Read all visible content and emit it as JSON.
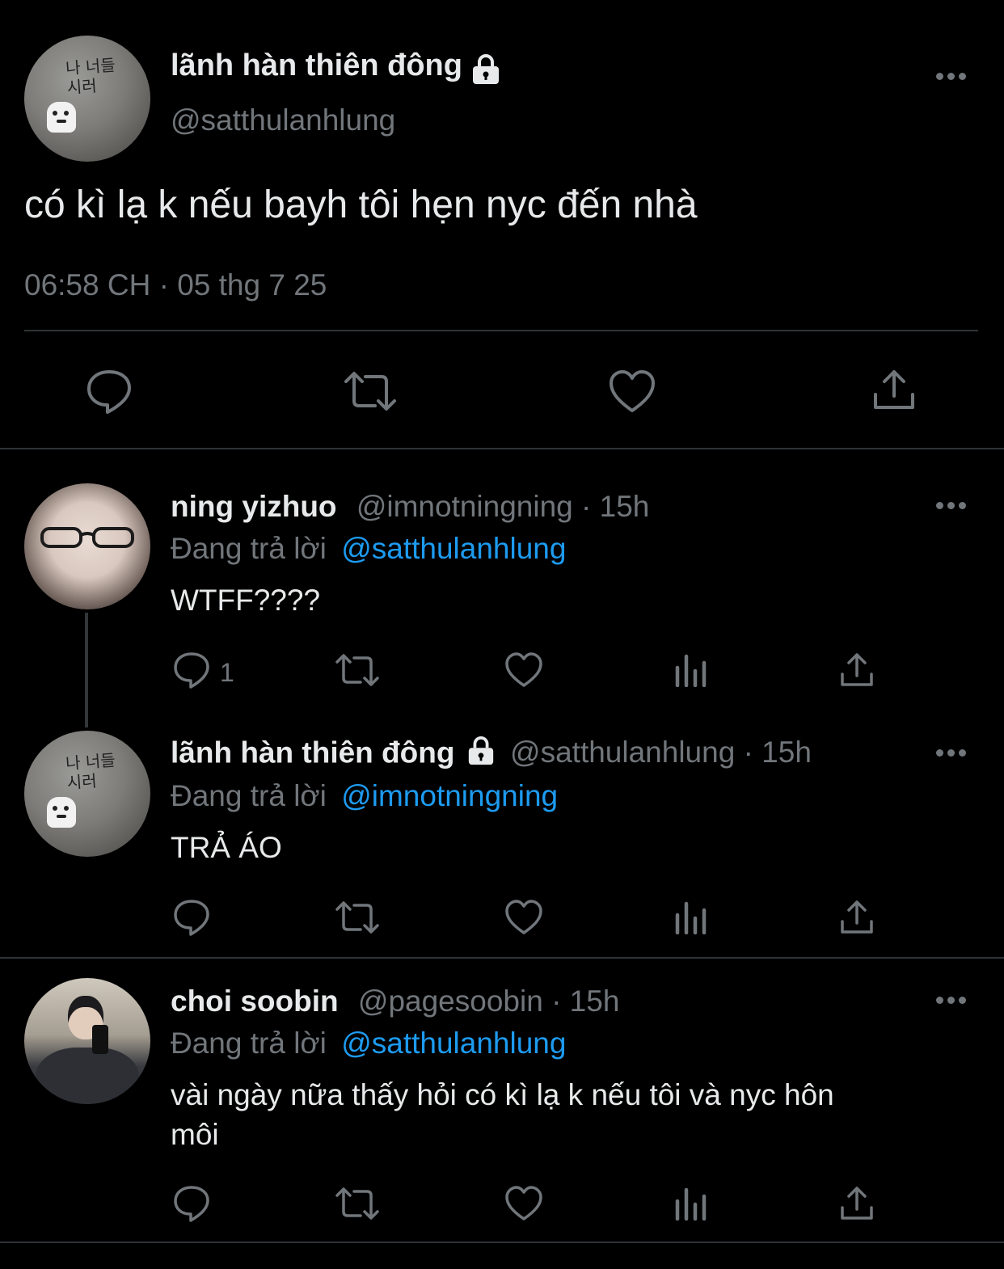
{
  "main_tweet": {
    "display_name": "lãnh hàn thiên đông",
    "handle": "@satthulanhlung",
    "text": "có kì lạ k nếu bayh tôi hẹn nyc đến nhà",
    "time": "06:58 CH · 05 thg 7 25",
    "avatar_graffiti": "나 너들 시러",
    "icons": [
      "reply-icon",
      "retweet-icon",
      "like-icon",
      "share-icon"
    ]
  },
  "replies": [
    {
      "display_name": "ning yizhuo",
      "meta": "@imnotningning · 15h",
      "replying_prefix": "Đang trả lời",
      "replying_to": "@satthulanhlung",
      "text": "WTFF????",
      "reply_count": "1"
    },
    {
      "display_name": "lãnh hàn thiên đông",
      "meta": "@satthulanhlung · 15h",
      "replying_prefix": "Đang trả lời",
      "replying_to": "@imnotningning",
      "text": "TRẢ ÁO",
      "reply_count": "",
      "avatar_graffiti": "나 너들 시러"
    },
    {
      "display_name": "choi soobin",
      "meta": "@pagesoobin · 15h",
      "replying_prefix": "Đang trả lời",
      "replying_to": "@satthulanhlung",
      "text_line1": "vài ngày nữa thấy hỏi có kì lạ k nếu tôi và nyc hôn",
      "text_line2": "môi",
      "reply_count": ""
    }
  ],
  "colors": {
    "background": "#000000",
    "text": "#e7e9ea",
    "secondary": "#71767b",
    "link": "#1d9bf0",
    "divider": "#2f3336"
  }
}
